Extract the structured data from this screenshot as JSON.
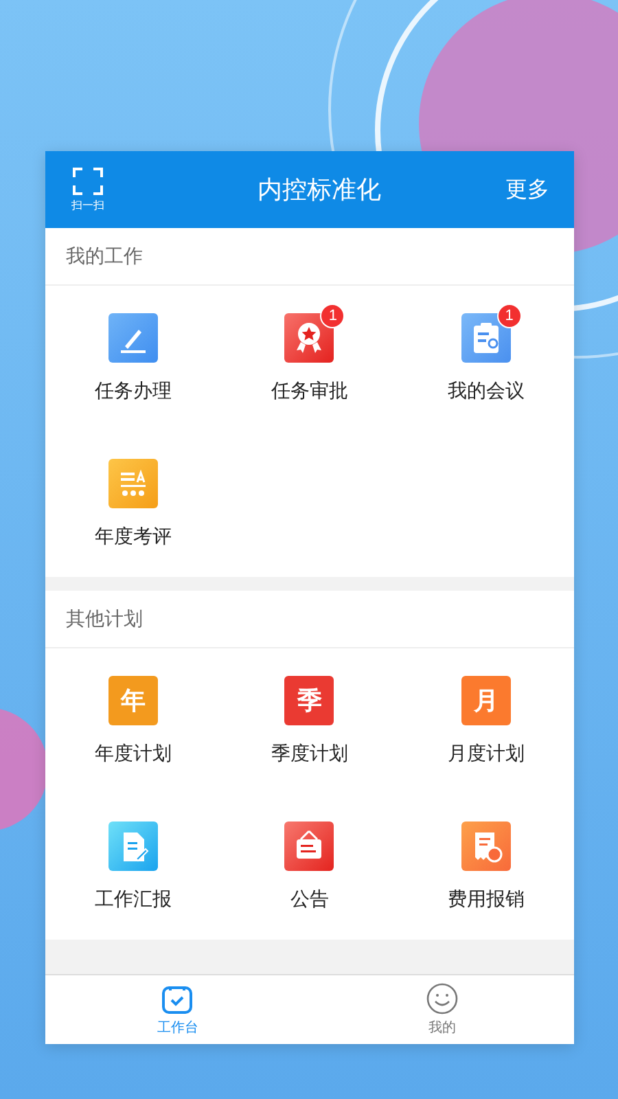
{
  "header": {
    "scan_label": "扫一扫",
    "title": "内控标准化",
    "more": "更多"
  },
  "sections": [
    {
      "title": "我的工作",
      "items": [
        {
          "label": "任务办理",
          "kind": "pen"
        },
        {
          "label": "任务审批",
          "kind": "award",
          "badge": "1"
        },
        {
          "label": "我的会议",
          "kind": "meeting",
          "badge": "1"
        },
        {
          "label": "年度考评",
          "kind": "rating"
        }
      ]
    },
    {
      "title": "其他计划",
      "items": [
        {
          "label": "年度计划",
          "kind": "glyph",
          "glyph": "年",
          "color": "#f39a1e"
        },
        {
          "label": "季度计划",
          "kind": "glyph",
          "glyph": "季",
          "color": "#ea3a32"
        },
        {
          "label": "月度计划",
          "kind": "glyph",
          "glyph": "月",
          "color": "#fb7a2e"
        },
        {
          "label": "工作汇报",
          "kind": "report"
        },
        {
          "label": "公告",
          "kind": "notice"
        },
        {
          "label": "费用报销",
          "kind": "expense"
        }
      ]
    }
  ],
  "tabs": [
    {
      "label": "工作台",
      "kind": "desk",
      "selected": true
    },
    {
      "label": "我的",
      "kind": "smile",
      "selected": false
    }
  ]
}
